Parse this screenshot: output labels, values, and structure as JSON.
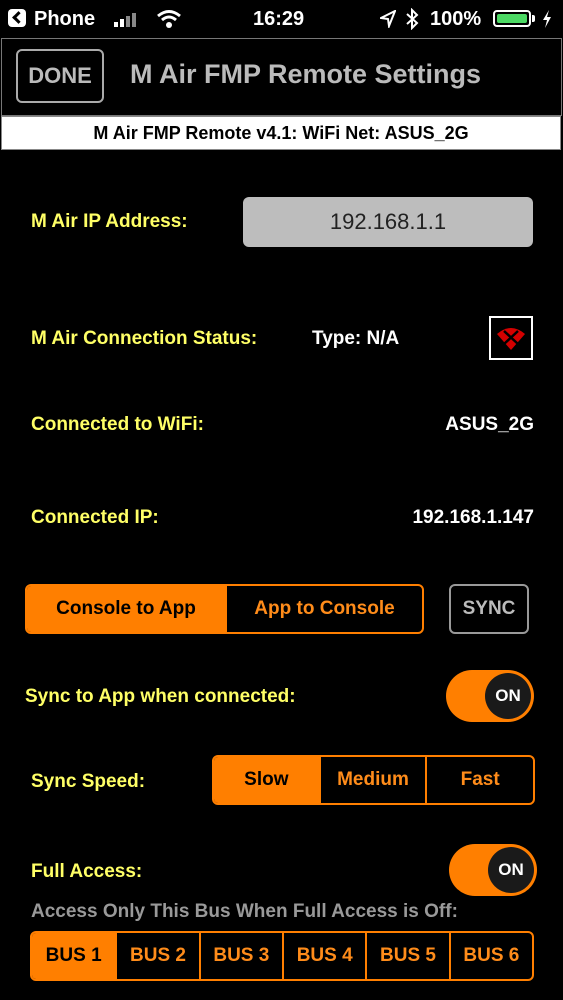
{
  "status_bar": {
    "carrier": "Phone",
    "time": "16:29",
    "battery": "100%"
  },
  "header": {
    "done_label": "DONE",
    "title": "M Air FMP Remote Settings",
    "subtitle": "M Air FMP Remote v4.1: WiFi Net: ASUS_2G"
  },
  "ip": {
    "label": "M Air IP Address:",
    "value": "192.168.1.1"
  },
  "connection": {
    "label": "M Air Connection Status:",
    "type": "Type: N/A"
  },
  "wifi": {
    "label": "Connected to WiFi:",
    "value": "ASUS_2G"
  },
  "connected_ip": {
    "label": "Connected IP:",
    "value": "192.168.1.147"
  },
  "direction": {
    "options": [
      "Console to App",
      "App to Console"
    ],
    "selected": 0,
    "sync_label": "SYNC"
  },
  "sync_on_connect": {
    "label": "Sync to App when connected:",
    "state": "ON"
  },
  "sync_speed": {
    "label": "Sync Speed:",
    "options": [
      "Slow",
      "Medium",
      "Fast"
    ],
    "selected": 0
  },
  "full_access": {
    "label": "Full Access:",
    "state": "ON",
    "bus_caption": "Access Only This Bus When Full Access is Off:",
    "buses": [
      "BUS 1",
      "BUS 2",
      "BUS 3",
      "BUS 4",
      "BUS 5",
      "BUS 6"
    ],
    "selected": 0
  },
  "colors": {
    "accent": "#ff7f00",
    "label_yellow": "#ffff66",
    "background": "#000000"
  }
}
